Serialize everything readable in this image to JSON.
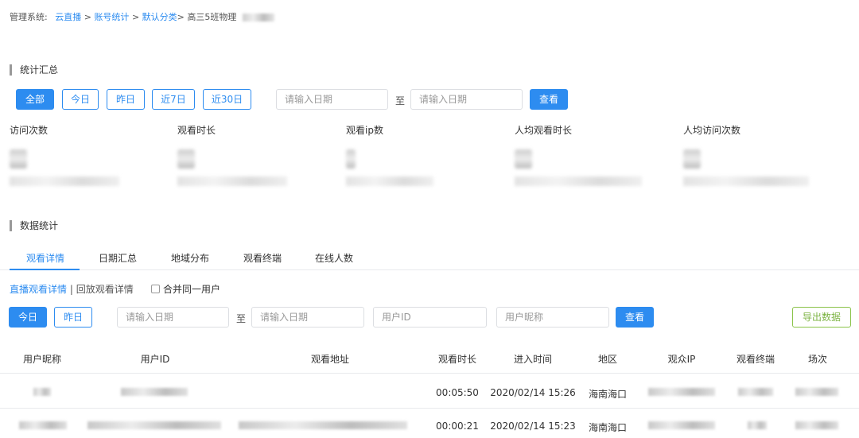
{
  "breadcrumb": {
    "prefix": "管理系统:",
    "item1": "云直播",
    "sep1": ">",
    "item2": "账号统计",
    "sep2": ">",
    "item3": "默认分类",
    "sep3": ">",
    "current": "高三5班物理"
  },
  "summary": {
    "title": "统计汇总",
    "filters": [
      "全部",
      "今日",
      "昨日",
      "近7日",
      "近30日"
    ],
    "date_start_placeholder": "请输入日期",
    "to": "至",
    "date_end_placeholder": "请输入日期",
    "view": "查看",
    "stats": [
      "访问次数",
      "观看时长",
      "观看ip数",
      "人均观看时长",
      "人均访问次数"
    ]
  },
  "data": {
    "title": "数据统计",
    "tabs": [
      "观看详情",
      "日期汇总",
      "地域分布",
      "观看终端",
      "在线人数"
    ],
    "subnav_live": "直播观看详情",
    "subnav_sep": "|",
    "subnav_replay": "回放观看详情",
    "merge_user": "合并同一用户",
    "today": "今日",
    "yesterday": "昨日",
    "date_start_placeholder": "请输入日期",
    "to": "至",
    "date_end_placeholder": "请输入日期",
    "userid_placeholder": "用户ID",
    "nickname_placeholder": "用户昵称",
    "view": "查看",
    "export": "导出数据"
  },
  "table": {
    "headers": [
      "用户昵称",
      "用户ID",
      "观看地址",
      "观看时长",
      "进入时间",
      "地区",
      "观众IP",
      "观看终端",
      "场次"
    ],
    "rows": [
      {
        "duration": "00:05:50",
        "enter_time": "2020/02/14 15:26",
        "region": "海南海口"
      },
      {
        "duration": "00:00:21",
        "enter_time": "2020/02/14 15:23",
        "region": "海南海口"
      }
    ]
  },
  "colors": {
    "accent": "#2d8cf0",
    "export": "#7cb342"
  }
}
